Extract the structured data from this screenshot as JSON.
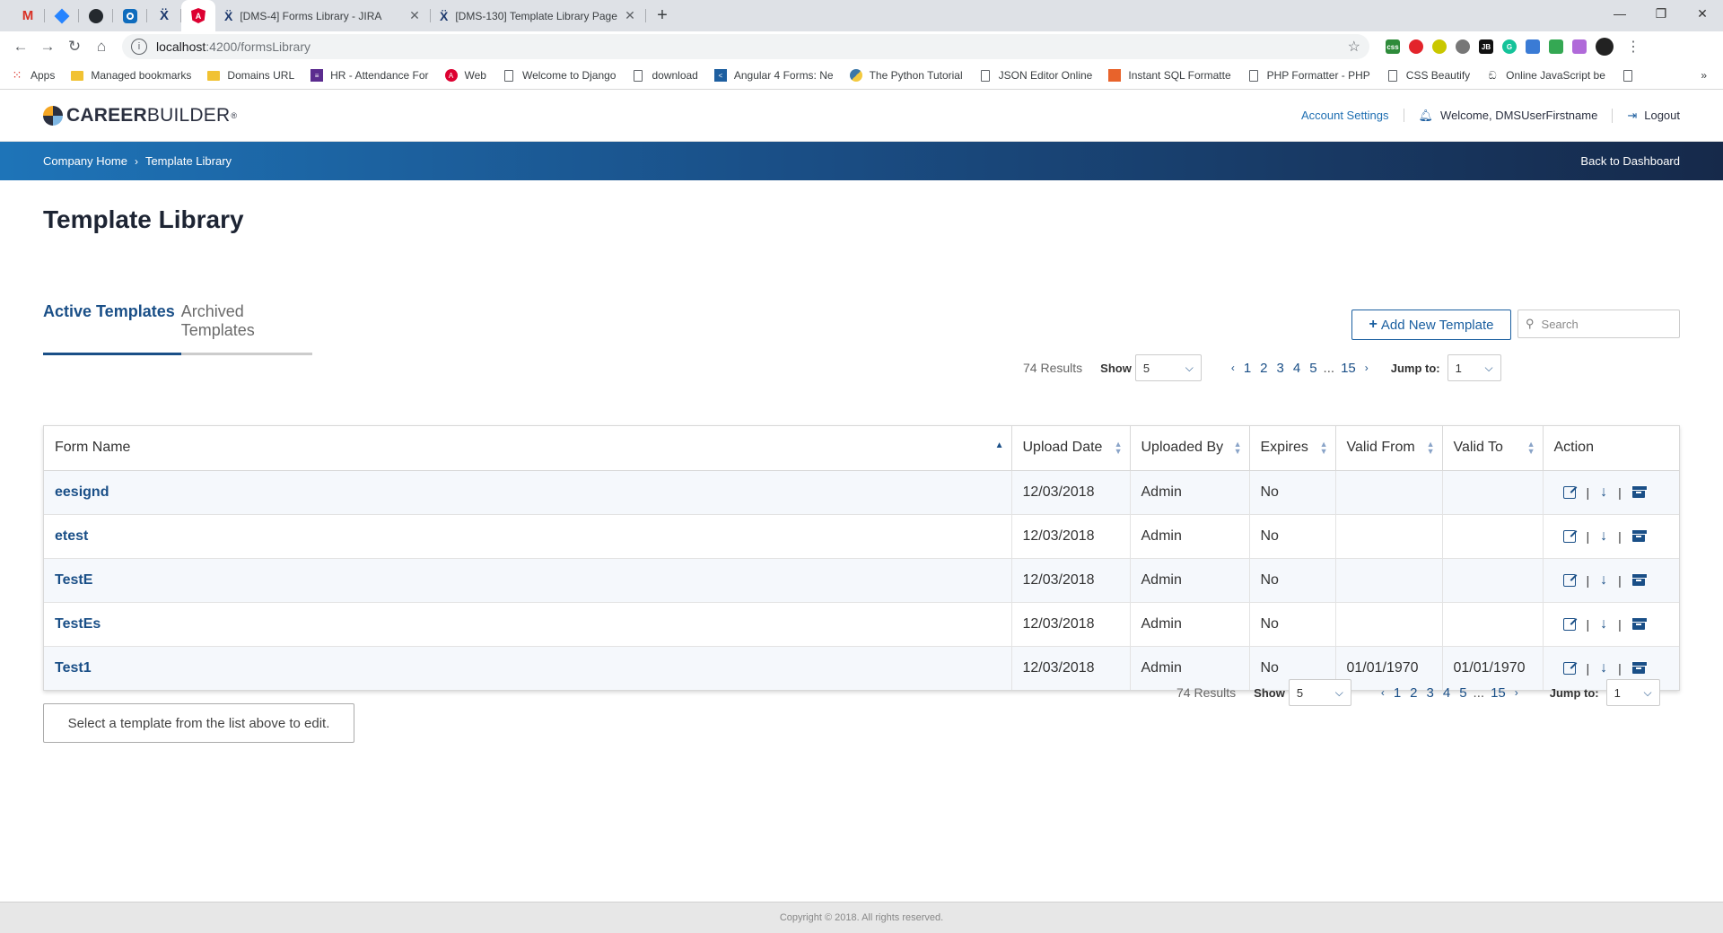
{
  "browser": {
    "tabs": [
      {
        "title": "[DMS-4] Forms Library - JIRA",
        "close": "✕"
      },
      {
        "title": "[DMS-130] Template Library Page",
        "close": "✕"
      }
    ],
    "new_tab": "+",
    "url_host": "localhost",
    "url_path": ":4200/formsLibrary",
    "bookmarks": [
      {
        "label": "Apps"
      },
      {
        "label": "Managed bookmarks"
      },
      {
        "label": "Domains URL"
      },
      {
        "label": "HR - Attendance For"
      },
      {
        "label": "Web"
      },
      {
        "label": "Welcome to Django"
      },
      {
        "label": "download"
      },
      {
        "label": "Angular 4 Forms: Ne"
      },
      {
        "label": "The Python Tutorial"
      },
      {
        "label": "JSON Editor Online"
      },
      {
        "label": "Instant SQL Formatte"
      },
      {
        "label": "PHP Formatter - PHP"
      },
      {
        "label": "CSS Beautify"
      },
      {
        "label": "Online JavaScript be"
      }
    ]
  },
  "header": {
    "logo_bold": "CAREER",
    "logo_thin": "BUILDER",
    "logo_reg": "®",
    "account_settings": "Account Settings",
    "welcome": "Welcome, DMSUserFirstname",
    "logout": "Logout"
  },
  "banner": {
    "crumb_home": "Company Home",
    "crumb_sep": "›",
    "crumb_current": "Template Library",
    "back": "Back to Dashboard"
  },
  "page": {
    "title": "Template Library",
    "tab_active": "Active Templates",
    "tab_archived": "Archived Templates",
    "add_button": "Add New Template",
    "search_placeholder": "Search",
    "select_message": "Select a template from the list above to edit."
  },
  "pager": {
    "results": "74 Results",
    "show_label": "Show",
    "show_value": "5",
    "prev": "‹",
    "next": "›",
    "pages": [
      "1",
      "2",
      "3",
      "4",
      "5"
    ],
    "ellipsis": "...",
    "last_page": "15",
    "jump_label": "Jump to:",
    "jump_value": "1"
  },
  "table": {
    "columns": [
      "Form Name",
      "Upload Date",
      "Uploaded By",
      "Expires",
      "Valid From",
      "Valid To",
      "Action"
    ],
    "rows": [
      {
        "name": "eesignd",
        "date": "12/03/2018",
        "by": "Admin",
        "expires": "No",
        "from": "",
        "to": ""
      },
      {
        "name": "etest",
        "date": "12/03/2018",
        "by": "Admin",
        "expires": "No",
        "from": "",
        "to": ""
      },
      {
        "name": "TestE",
        "date": "12/03/2018",
        "by": "Admin",
        "expires": "No",
        "from": "",
        "to": ""
      },
      {
        "name": "TestEs",
        "date": "12/03/2018",
        "by": "Admin",
        "expires": "No",
        "from": "",
        "to": ""
      },
      {
        "name": "Test1",
        "date": "12/03/2018",
        "by": "Admin",
        "expires": "No",
        "from": "01/01/1970",
        "to": "01/01/1970"
      }
    ],
    "action_sep": "|"
  },
  "footer": {
    "copyright": "Copyright © 2018. All rights reserved."
  },
  "colors": {
    "brand_blue": "#1a4f87",
    "link_blue": "#1f6fb2",
    "banner_start": "#1e74b8",
    "banner_end": "#16294a"
  }
}
